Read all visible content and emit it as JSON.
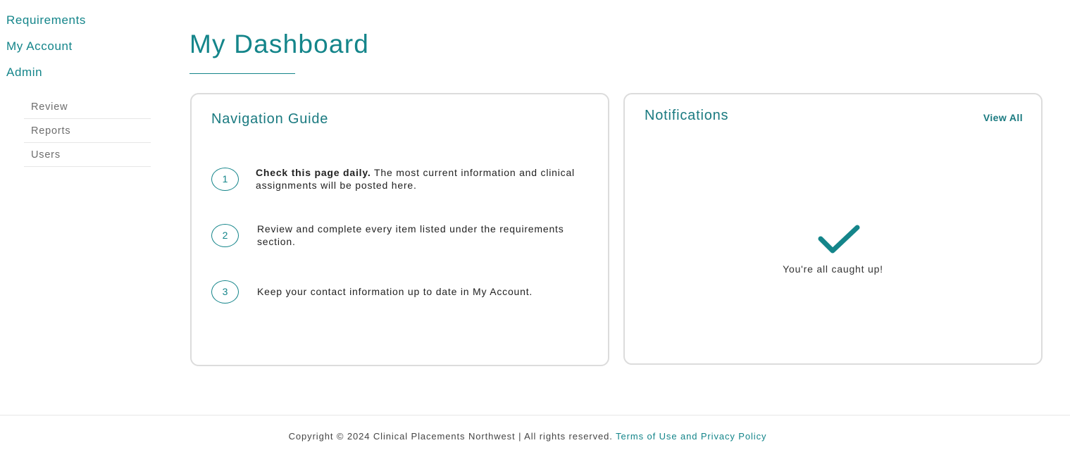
{
  "sidebar": {
    "items": [
      {
        "label": "Requirements"
      },
      {
        "label": "My Account"
      },
      {
        "label": "Admin"
      }
    ],
    "subitems": [
      {
        "label": "Review"
      },
      {
        "label": "Reports"
      },
      {
        "label": "Users"
      }
    ]
  },
  "page": {
    "title": "My Dashboard"
  },
  "guide": {
    "title": "Navigation Guide",
    "steps": [
      {
        "num": "1",
        "bold": "Check this page daily.",
        "text": " The most current information and clinical assignments will be posted here."
      },
      {
        "num": "2",
        "bold": "",
        "text": "Review and complete every item listed under the requirements section."
      },
      {
        "num": "3",
        "bold": "",
        "text": "Keep your contact information up to date in My Account."
      }
    ]
  },
  "notifications": {
    "title": "Notifications",
    "view_all": "View All",
    "empty_icon": "checkmark-icon",
    "empty_message": "You're all caught up!"
  },
  "footer": {
    "copyright": "Copyright © 2024 Clinical Placements Northwest | All rights reserved.",
    "link": "Terms of Use and Privacy Policy"
  },
  "colors": {
    "accent": "#14858a",
    "border": "#dcdcdc"
  }
}
